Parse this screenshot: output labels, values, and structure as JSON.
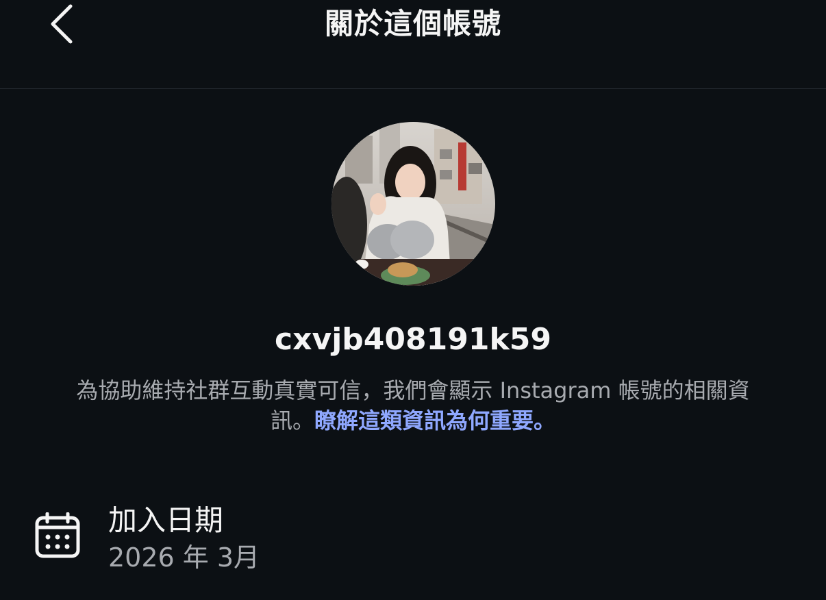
{
  "header": {
    "title": "關於這個帳號",
    "back_icon": "chevron-left-icon"
  },
  "profile": {
    "username": "cxvjb408191k59",
    "avatar_description": "profile-photo"
  },
  "info": {
    "text": "為協助維持社群互動真實可信，我們會顯示 Instagram 帳號的相關資訊。",
    "link_text": "瞭解這類資訊為何重要。",
    "link_color": "#8fa8ff"
  },
  "details": {
    "date_joined": {
      "icon": "calendar-icon",
      "label": "加入日期",
      "value": "2026 年 3月"
    }
  },
  "colors": {
    "background": "#0c1014",
    "text_primary": "#f5f5f5",
    "text_secondary": "#a8abb0",
    "divider": "#262b31"
  }
}
